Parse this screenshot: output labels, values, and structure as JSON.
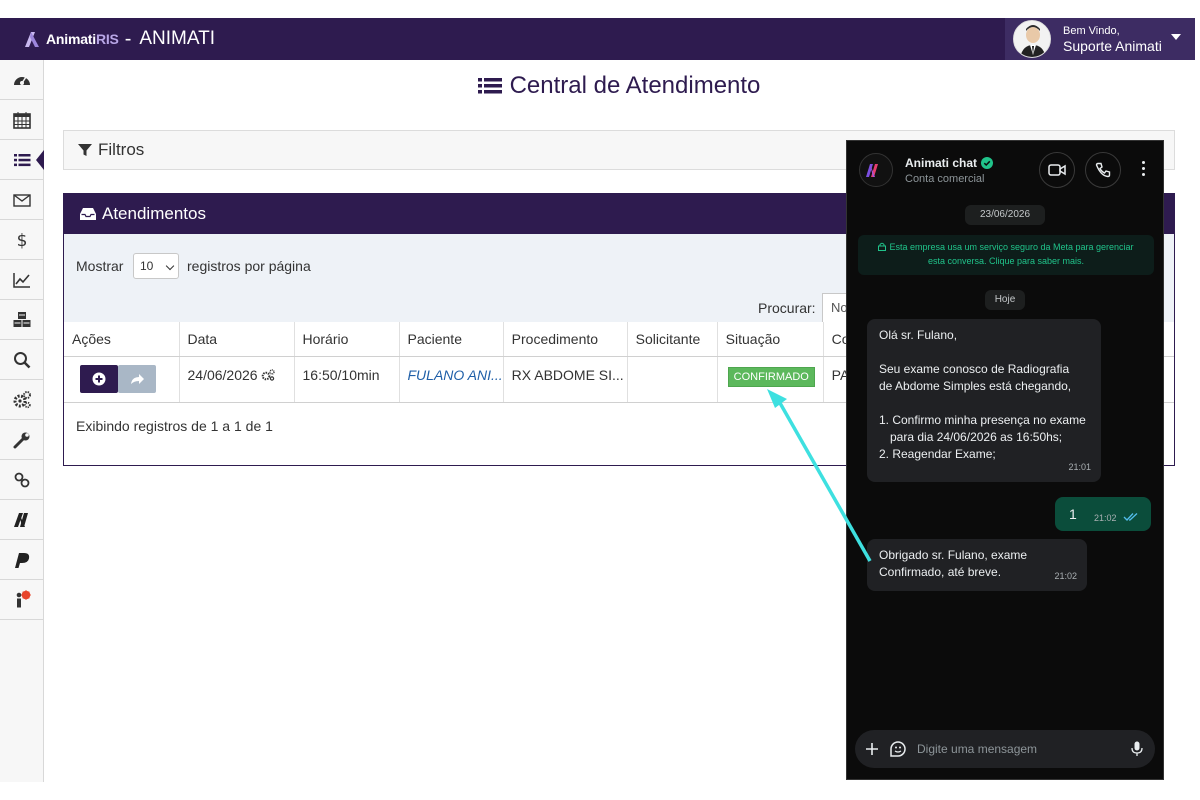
{
  "header": {
    "brand_name": "Animati",
    "brand_ris": "RIS",
    "brand_sep": "-",
    "app_title": "ANIMATI",
    "welcome": "Bem Vindo,",
    "user_name": "Suporte Animati"
  },
  "sidebar": {
    "items": [
      {
        "icon": "dashboard-icon"
      },
      {
        "icon": "calendar-icon"
      },
      {
        "icon": "list-icon",
        "active": true
      },
      {
        "icon": "envelope-icon"
      },
      {
        "icon": "dollar-icon"
      },
      {
        "icon": "line-chart-icon"
      },
      {
        "icon": "cubes-icon"
      },
      {
        "icon": "search-icon"
      },
      {
        "icon": "gears-icon"
      },
      {
        "icon": "wrench-icon"
      },
      {
        "icon": "link-icon"
      },
      {
        "icon": "animati-n-icon"
      },
      {
        "icon": "p-logo-icon"
      },
      {
        "icon": "person-alert-icon"
      }
    ]
  },
  "main": {
    "title": "Central de Atendimento",
    "filter_label": "Filtros",
    "panel_title": "Atendimentos",
    "show_label": "Mostrar",
    "page_length": "10",
    "per_page_label": "registros por página",
    "search_label": "Procurar:",
    "search_value": "No",
    "columns": [
      "Ações",
      "Data",
      "Horário",
      "Paciente",
      "Procedimento",
      "Solicitante",
      "Situação",
      "Co"
    ],
    "rows": [
      {
        "data": "24/06/2026",
        "horario": "16:50/10min",
        "paciente": "FULANO ANI...",
        "procedimento": "RX ABDOME SI...",
        "solicitante": "",
        "situacao": "CONFIRMADO",
        "convenio": "PA"
      }
    ],
    "footer_info": "Exibindo registros de 1 a 1 de 1"
  },
  "chat": {
    "name": "Animati chat",
    "subtitle": "Conta comercial",
    "date": "23/06/2026",
    "notice_line1": "Esta empresa usa um serviço seguro da Meta para gerenciar",
    "notice_line2": "esta conversa. Clique para saber mais.",
    "today": "Hoje",
    "msg1_greeting": "Olá sr. Fulano,",
    "msg1_line1": "Seu exame conosco de Radiografia",
    "msg1_line2": "de Abdome Simples está chegando,",
    "msg1_opt1a": "1. Confirmo minha presença no exame",
    "msg1_opt1b": "para dia 24/06/2026 as 16:50hs;",
    "msg1_opt2": "2. Reagendar Exame;",
    "msg1_time": "21:01",
    "reply_text": "1",
    "reply_time": "21:02",
    "msg2_line1": "Obrigado sr. Fulano, exame",
    "msg2_line2": "Confirmado, até breve.",
    "msg2_time": "21:02",
    "composer_placeholder": "Digite uma mensagem"
  },
  "colors": {
    "brand": "#2e1b4f",
    "confirmed": "#5cb85c",
    "arrow": "#3ee0e0",
    "chat_accent": "#20c38a"
  }
}
